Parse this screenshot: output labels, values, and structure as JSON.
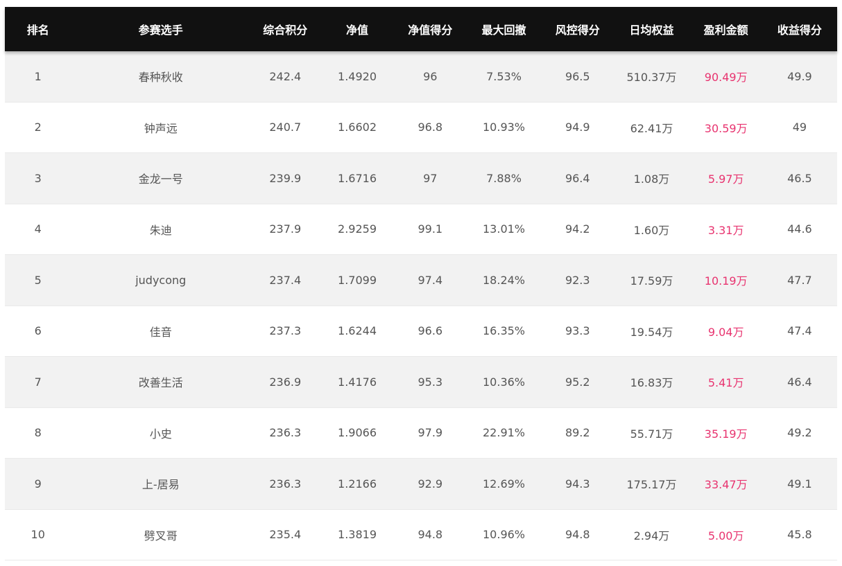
{
  "table": {
    "headers": {
      "rank": "排名",
      "player": "参赛选手",
      "total_score": "综合积分",
      "nav": "净值",
      "nav_score": "净值得分",
      "max_drawdown": "最大回撤",
      "risk_score": "风控得分",
      "avg_daily_equity": "日均权益",
      "profit_amount": "盈利金额",
      "return_score": "收益得分"
    },
    "rows": [
      {
        "rank": "1",
        "player": "春种秋收",
        "total_score": "242.4",
        "nav": "1.4920",
        "nav_score": "96",
        "max_drawdown": "7.53%",
        "risk_score": "96.5",
        "avg_daily_equity": "510.37万",
        "profit_amount": "90.49万",
        "return_score": "49.9"
      },
      {
        "rank": "2",
        "player": "钟声远",
        "total_score": "240.7",
        "nav": "1.6602",
        "nav_score": "96.8",
        "max_drawdown": "10.93%",
        "risk_score": "94.9",
        "avg_daily_equity": "62.41万",
        "profit_amount": "30.59万",
        "return_score": "49"
      },
      {
        "rank": "3",
        "player": "金龙一号",
        "total_score": "239.9",
        "nav": "1.6716",
        "nav_score": "97",
        "max_drawdown": "7.88%",
        "risk_score": "96.4",
        "avg_daily_equity": "1.08万",
        "profit_amount": "5.97万",
        "return_score": "46.5"
      },
      {
        "rank": "4",
        "player": "朱迪",
        "total_score": "237.9",
        "nav": "2.9259",
        "nav_score": "99.1",
        "max_drawdown": "13.01%",
        "risk_score": "94.2",
        "avg_daily_equity": "1.60万",
        "profit_amount": "3.31万",
        "return_score": "44.6"
      },
      {
        "rank": "5",
        "player": "judycong",
        "total_score": "237.4",
        "nav": "1.7099",
        "nav_score": "97.4",
        "max_drawdown": "18.24%",
        "risk_score": "92.3",
        "avg_daily_equity": "17.59万",
        "profit_amount": "10.19万",
        "return_score": "47.7"
      },
      {
        "rank": "6",
        "player": "佳音",
        "total_score": "237.3",
        "nav": "1.6244",
        "nav_score": "96.6",
        "max_drawdown": "16.35%",
        "risk_score": "93.3",
        "avg_daily_equity": "19.54万",
        "profit_amount": "9.04万",
        "return_score": "47.4"
      },
      {
        "rank": "7",
        "player": "改善生活",
        "total_score": "236.9",
        "nav": "1.4176",
        "nav_score": "95.3",
        "max_drawdown": "10.36%",
        "risk_score": "95.2",
        "avg_daily_equity": "16.83万",
        "profit_amount": "5.41万",
        "return_score": "46.4"
      },
      {
        "rank": "8",
        "player": "小史",
        "total_score": "236.3",
        "nav": "1.9066",
        "nav_score": "97.9",
        "max_drawdown": "22.91%",
        "risk_score": "89.2",
        "avg_daily_equity": "55.71万",
        "profit_amount": "35.19万",
        "return_score": "49.2"
      },
      {
        "rank": "9",
        "player": "上-居易",
        "total_score": "236.3",
        "nav": "1.2166",
        "nav_score": "92.9",
        "max_drawdown": "12.69%",
        "risk_score": "94.3",
        "avg_daily_equity": "175.17万",
        "profit_amount": "33.47万",
        "return_score": "49.1"
      },
      {
        "rank": "10",
        "player": "劈叉哥",
        "total_score": "235.4",
        "nav": "1.3819",
        "nav_score": "94.8",
        "max_drawdown": "10.96%",
        "risk_score": "94.8",
        "avg_daily_equity": "2.94万",
        "profit_amount": "5.00万",
        "return_score": "45.8"
      }
    ]
  },
  "colors": {
    "header_bg": "#111111",
    "header_text": "#ffffff",
    "row_alt_bg": "#f2f2f2",
    "row_bg": "#ffffff",
    "body_text": "#555555",
    "profit_text": "#e8336f"
  }
}
